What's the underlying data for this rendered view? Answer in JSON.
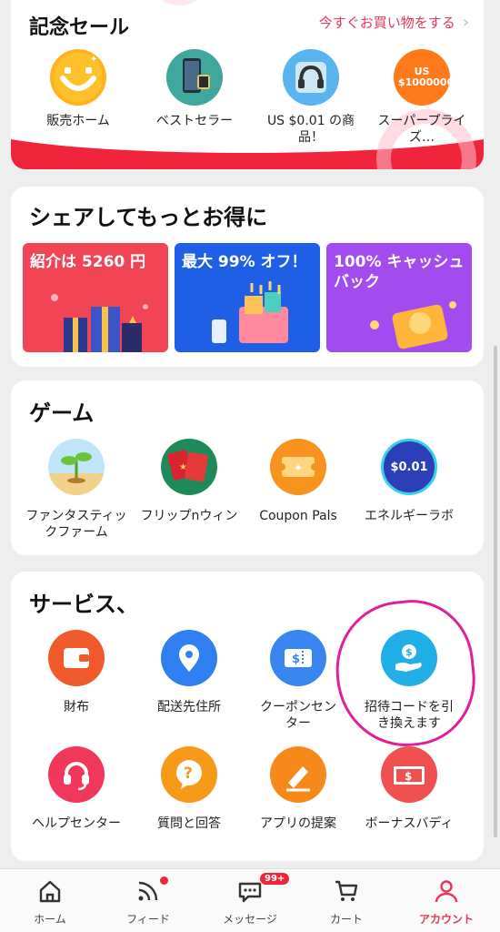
{
  "sale": {
    "title": "記念セール",
    "link": "今すぐお買い物をする",
    "items": [
      {
        "label": "販売ホーム"
      },
      {
        "label": "ベストセラー"
      },
      {
        "label": "US $0.01 の商品！"
      },
      {
        "label": "スーパープライズ…",
        "icon_text": "US $1000000"
      }
    ]
  },
  "share": {
    "title": "シェアしてもっとお得に",
    "promos": [
      {
        "label": "紹介は 5260 円"
      },
      {
        "label": "最大 99% オフ！"
      },
      {
        "label": "100% キャッシュバック"
      }
    ]
  },
  "game": {
    "title": "ゲーム",
    "items": [
      {
        "label": "ファンタスティックファーム"
      },
      {
        "label": "フリップnウィン"
      },
      {
        "label": "Coupon Pals"
      },
      {
        "label": "エネルギーラボ",
        "icon_text": "$0.01"
      }
    ]
  },
  "service": {
    "title": "サービス、",
    "items": [
      {
        "label": "財布"
      },
      {
        "label": "配送先住所"
      },
      {
        "label": "クーポンセンター"
      },
      {
        "label": "招待コードを引き換えます"
      },
      {
        "label": "ヘルプセンター"
      },
      {
        "label": "質問と回答"
      },
      {
        "label": "アプリの提案"
      },
      {
        "label": "ボーナスバディ"
      }
    ]
  },
  "nav": {
    "items": [
      {
        "label": "ホーム",
        "icon": "home-icon"
      },
      {
        "label": "フィード",
        "icon": "feed-icon"
      },
      {
        "label": "メッセージ",
        "icon": "message-icon",
        "badge": "99+"
      },
      {
        "label": "カート",
        "icon": "cart-icon"
      },
      {
        "label": "アカウント",
        "icon": "account-icon",
        "active": true
      }
    ]
  },
  "colors": {
    "accent": "#e8355a",
    "red": "#f0243b",
    "annotation": "#e0209a"
  }
}
